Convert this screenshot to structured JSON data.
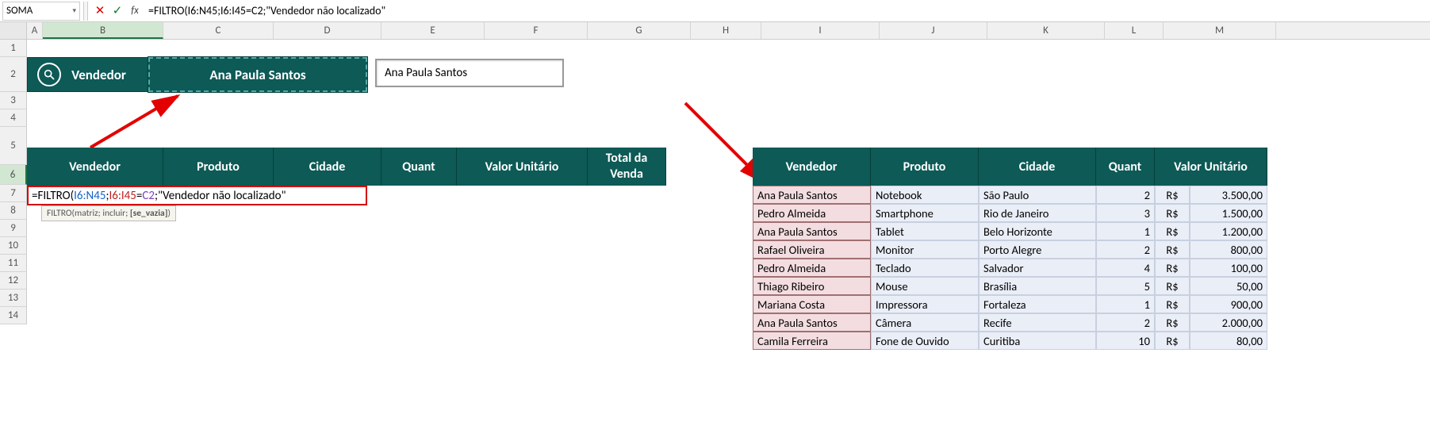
{
  "name_box": "SOMA",
  "formula_bar": "=FILTRO(I6:N45;I6:I45=C2;\"Vendedor não localizado\"",
  "row2": {
    "vendedor_label": "Vendedor",
    "selected": "Ana Paula Santos",
    "dropdown": "Ana Paula Santos"
  },
  "left_headers": [
    "Vendedor",
    "Produto",
    "Cidade",
    "Quant",
    "Valor Unitário",
    "Total da\nVenda"
  ],
  "formula_cell": "=FILTRO(I6:N45;I6:I45=C2;\"Vendedor não localizado\"",
  "tooltip": "FILTRO(matriz; incluir; [se_vazia])",
  "right_headers": [
    "Vendedor",
    "Produto",
    "Cidade",
    "Quant",
    "Valor Unitário"
  ],
  "rows": [
    {
      "v": "Ana Paula Santos",
      "p": "Notebook",
      "c": "São Paulo",
      "q": "2",
      "r": "R$",
      "m": "3.500,00"
    },
    {
      "v": "Pedro Almeida",
      "p": "Smartphone",
      "c": "Rio de Janeiro",
      "q": "3",
      "r": "R$",
      "m": "1.500,00"
    },
    {
      "v": "Ana Paula Santos",
      "p": "Tablet",
      "c": "Belo Horizonte",
      "q": "1",
      "r": "R$",
      "m": "1.200,00"
    },
    {
      "v": "Rafael Oliveira",
      "p": "Monitor",
      "c": "Porto Alegre",
      "q": "2",
      "r": "R$",
      "m": "800,00"
    },
    {
      "v": "Pedro Almeida",
      "p": "Teclado",
      "c": "Salvador",
      "q": "4",
      "r": "R$",
      "m": "100,00"
    },
    {
      "v": "Thiago Ribeiro",
      "p": "Mouse",
      "c": "Brasília",
      "q": "5",
      "r": "R$",
      "m": "50,00"
    },
    {
      "v": "Mariana Costa",
      "p": "Impressora",
      "c": "Fortaleza",
      "q": "1",
      "r": "R$",
      "m": "900,00"
    },
    {
      "v": "Ana Paula Santos",
      "p": "Câmera",
      "c": "Recife",
      "q": "2",
      "r": "R$",
      "m": "2.000,00"
    },
    {
      "v": "Camila Ferreira",
      "p": "Fone de Ouvido",
      "c": "Curitiba",
      "q": "10",
      "r": "R$",
      "m": "80,00"
    }
  ],
  "cols": [
    "A",
    "B",
    "C",
    "D",
    "E",
    "F",
    "G",
    "H",
    "I",
    "J",
    "K",
    "L",
    "M"
  ],
  "rownums": [
    "1",
    "2",
    "3",
    "4",
    "5",
    "6",
    "7",
    "8",
    "9",
    "10",
    "11",
    "12",
    "13",
    "14"
  ]
}
